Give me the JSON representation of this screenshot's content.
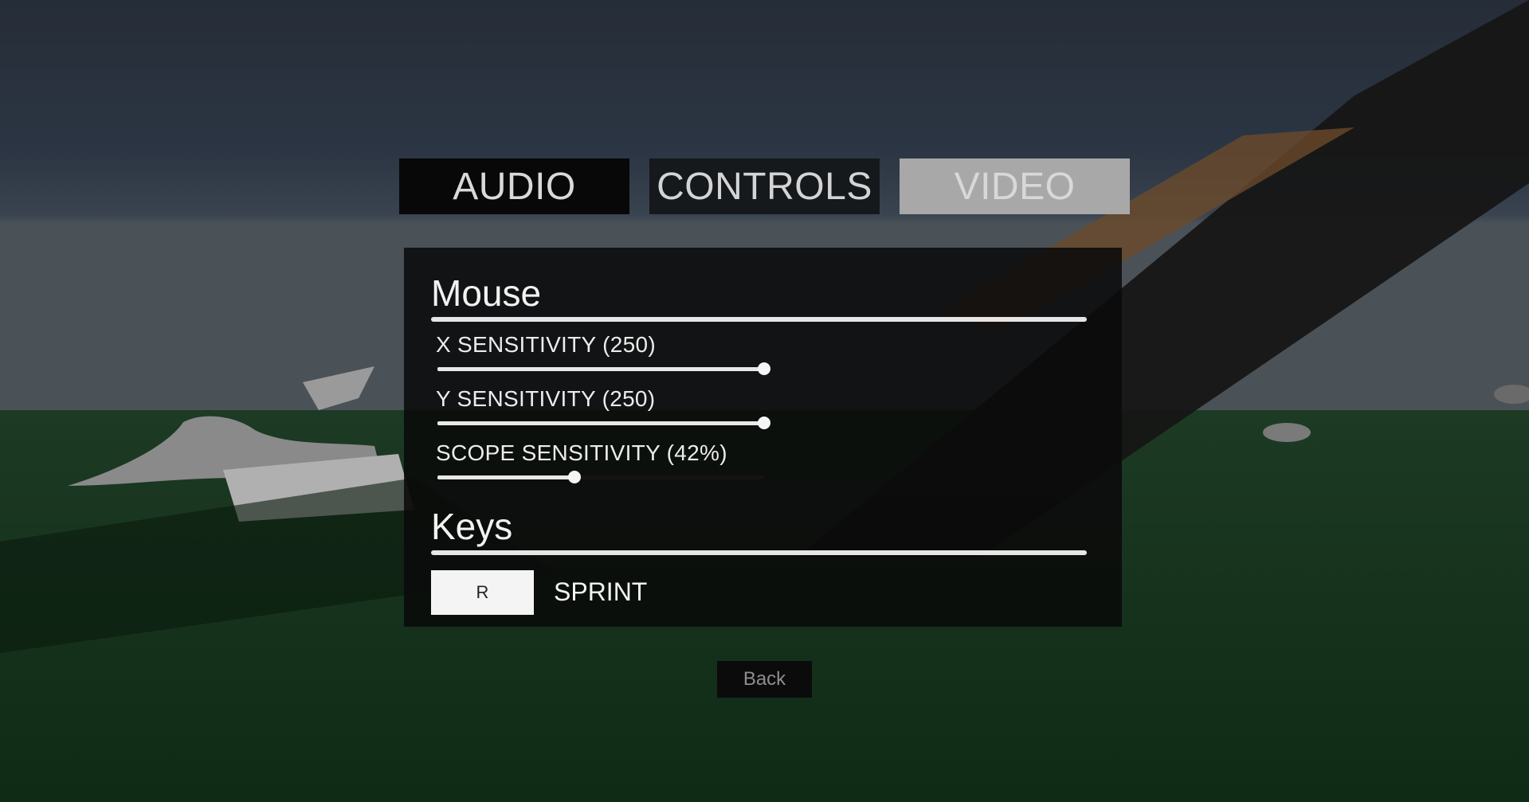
{
  "tabs": [
    {
      "label": "AUDIO"
    },
    {
      "label": "CONTROLS"
    },
    {
      "label": "VIDEO"
    }
  ],
  "mouse_section": {
    "title": "Mouse",
    "sliders": [
      {
        "label": "X SENSITIVITY (250)",
        "fraction": 1.0
      },
      {
        "label": "Y SENSITIVITY (250)",
        "fraction": 1.0
      },
      {
        "label": "SCOPE SENSITIVITY (42%)",
        "fraction": 0.42
      }
    ]
  },
  "keys_section": {
    "title": "Keys",
    "bindings": [
      {
        "key": "R",
        "action": "SPRINT"
      }
    ]
  },
  "back_label": "Back"
}
